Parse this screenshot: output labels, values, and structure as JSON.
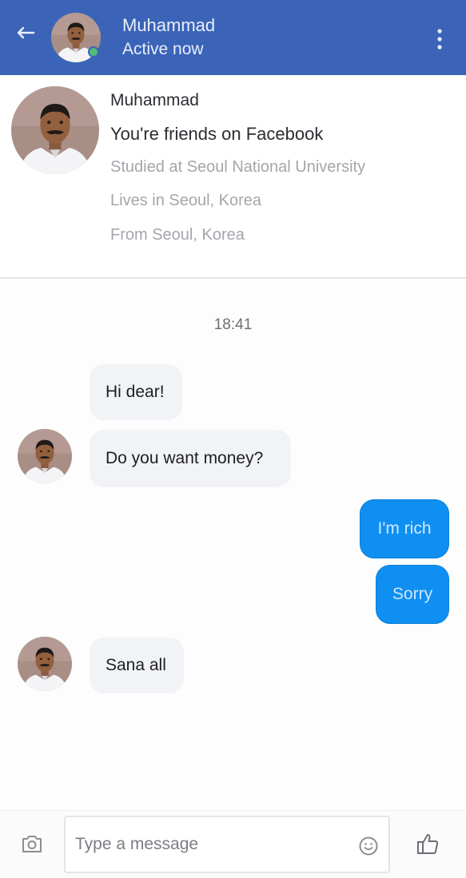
{
  "header": {
    "name": "Muhammad",
    "status": "Active now"
  },
  "profile": {
    "name": "Muhammad",
    "friends": "You're friends on Facebook",
    "studied": "Studied at Seoul National University",
    "lives": "Lives in Seoul, Korea",
    "from": "From Seoul, Korea"
  },
  "thread": {
    "timestamp": "18:41",
    "messages": [
      {
        "text": "Hi dear!",
        "sender": "other"
      },
      {
        "text": "Do you want money?",
        "sender": "other"
      },
      {
        "text": "I'm rich",
        "sender": "me"
      },
      {
        "text": "Sorry",
        "sender": "me"
      },
      {
        "text": "Sana all",
        "sender": "other"
      }
    ]
  },
  "composer": {
    "placeholder": "Type a message"
  },
  "colors": {
    "header_bg": "#3b64b8",
    "outgoing_bubble": "#0f8ff2",
    "incoming_bubble": "#f2f3f6",
    "presence": "#4fbf74"
  },
  "icons": [
    "back-arrow-icon",
    "more-vertical-icon",
    "camera-icon",
    "emoji-icon",
    "thumbs-up-icon"
  ]
}
